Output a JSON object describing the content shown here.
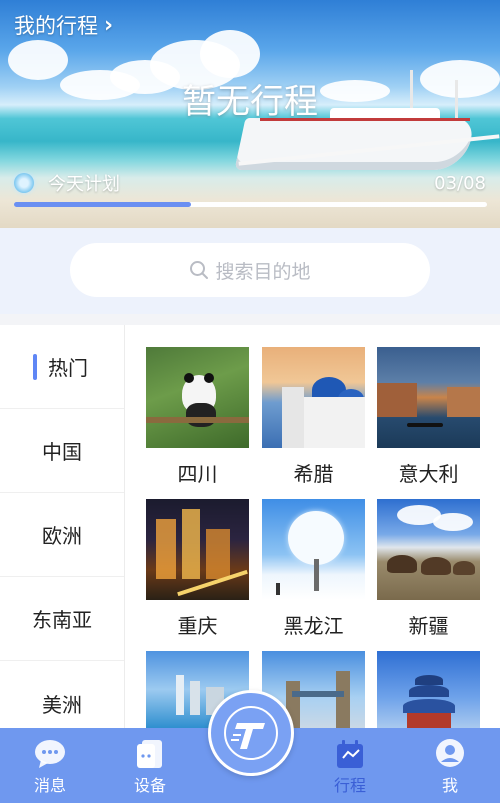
{
  "hero": {
    "my_trip_label": "我的行程",
    "status_title": "暂无行程",
    "plan_label": "今天计划",
    "plan_count": "03/08",
    "plan_progress": 0.375
  },
  "search": {
    "placeholder": "搜索目的地"
  },
  "categories": [
    {
      "label": "热门",
      "active": true
    },
    {
      "label": "中国",
      "active": false
    },
    {
      "label": "欧洲",
      "active": false
    },
    {
      "label": "东南亚",
      "active": false
    },
    {
      "label": "美洲",
      "active": false
    }
  ],
  "destinations": [
    {
      "label": "四川"
    },
    {
      "label": "希腊"
    },
    {
      "label": "意大利"
    },
    {
      "label": "重庆"
    },
    {
      "label": "黑龙江"
    },
    {
      "label": "新疆"
    },
    {
      "label": ""
    },
    {
      "label": ""
    },
    {
      "label": ""
    }
  ],
  "tabs": [
    {
      "label": "消息",
      "icon": "chat-icon",
      "active": false
    },
    {
      "label": "设备",
      "icon": "device-icon",
      "active": false
    },
    {
      "label": "行程",
      "icon": "calendar-icon",
      "active": true
    },
    {
      "label": "我",
      "icon": "profile-icon",
      "active": false
    }
  ],
  "colors": {
    "accent": "#6f98ef",
    "active_tab": "#3a5fd6",
    "progress": "#6a8ff2"
  }
}
